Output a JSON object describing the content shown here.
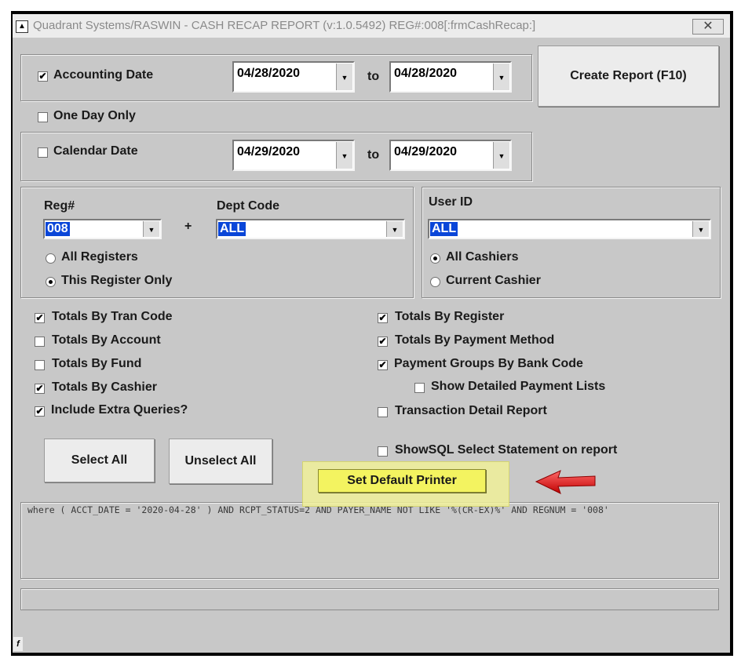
{
  "window": {
    "title": "Quadrant Systems/RASWIN - CASH RECAP REPORT (v:1.0.5492) REG#:008[:frmCashRecap:]",
    "close_glyph": "✕"
  },
  "accounting_date": {
    "label": "Accounting Date",
    "checked": true,
    "from": "04/28/2020",
    "to_label": "to",
    "to": "04/28/2020"
  },
  "one_day_only": {
    "label": "One Day Only",
    "checked": false
  },
  "calendar_date": {
    "label": "Calendar Date",
    "checked": false,
    "from": "04/29/2020",
    "to_label": "to",
    "to": "04/29/2020"
  },
  "create_report_label": "Create Report (F10)",
  "register": {
    "reg_label": "Reg#",
    "reg_value": "008",
    "plus": "+",
    "dept_label": "Dept Code",
    "dept_value": "ALL",
    "all_registers": "All Registers",
    "this_register_only": "This Register Only",
    "selected": "This Register Only"
  },
  "user": {
    "label": "User ID",
    "value": "ALL",
    "all_cashiers": "All Cashiers",
    "current_cashier": "Current Cashier",
    "selected": "All Cashiers"
  },
  "options_left": [
    {
      "label": "Totals By Tran Code",
      "checked": true
    },
    {
      "label": "Totals By Account",
      "checked": false
    },
    {
      "label": "Totals By Fund",
      "checked": false
    },
    {
      "label": "Totals By Cashier",
      "checked": true
    },
    {
      "label": "Include Extra Queries?",
      "checked": true
    }
  ],
  "options_right": [
    {
      "label": "Totals By Register",
      "checked": true
    },
    {
      "label": "Totals By Payment Method",
      "checked": true
    },
    {
      "label": "Payment Groups By Bank Code",
      "checked": true
    },
    {
      "label": "Show Detailed Payment Lists",
      "checked": false
    },
    {
      "label": "Transaction Detail Report",
      "checked": false
    },
    {
      "label": "ShowSQL Select Statement on report",
      "checked": false
    }
  ],
  "buttons": {
    "select_all": "Select All",
    "unselect_all": "Unselect All",
    "set_default_printer": "Set Default Printer"
  },
  "sql_text": "where ( ACCT_DATE = '2020-04-28' ) AND RCPT_STATUS=2 AND PAYER_NAME NOT LIKE '%(CR-EX)%' AND REGNUM = '008'",
  "corner_glyph": "f",
  "colors": {
    "highlight": "#f3f360",
    "arrow": "#e01010",
    "selection": "#0a46d8"
  }
}
